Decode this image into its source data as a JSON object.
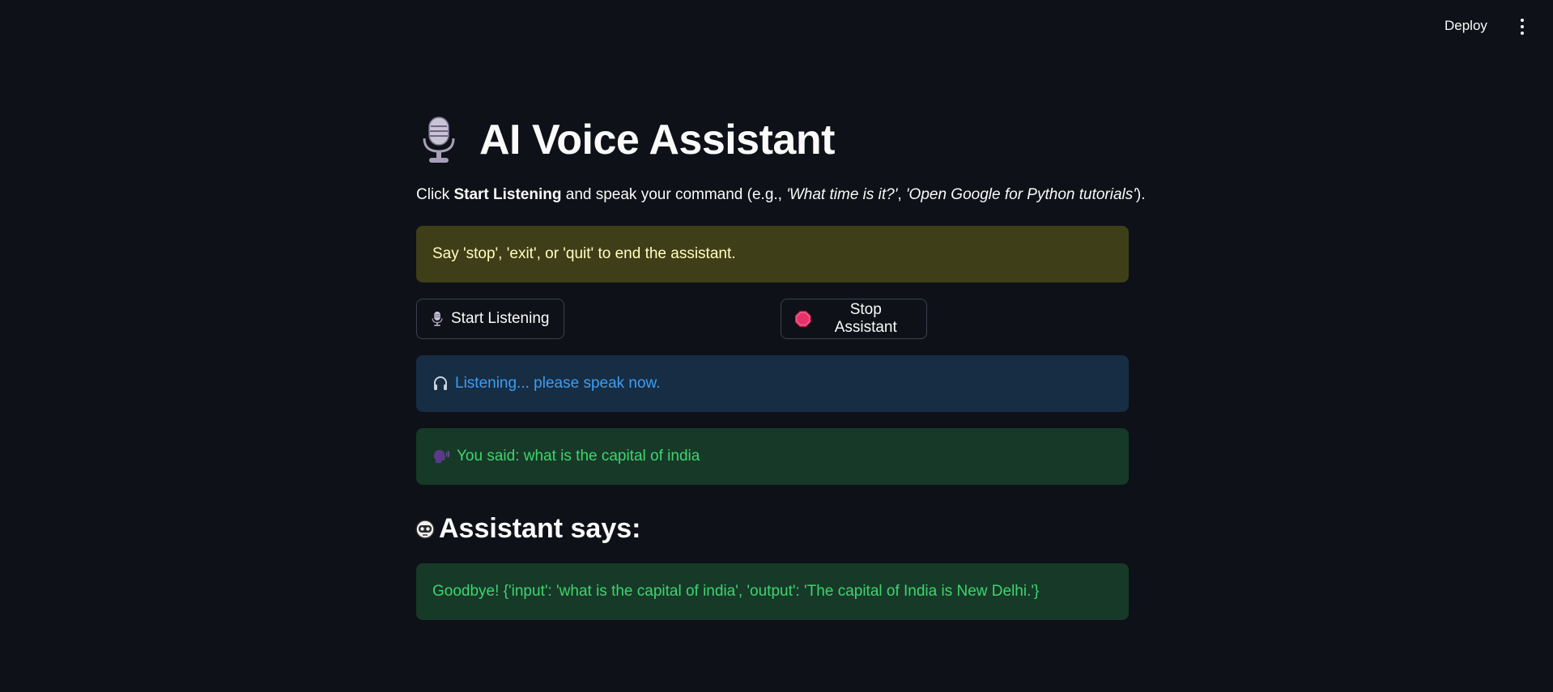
{
  "header": {
    "deploy_label": "Deploy",
    "menu_icon": "kebab-menu-icon"
  },
  "page": {
    "title_icon": "microphone-icon",
    "title": "AI Voice Assistant",
    "intro": {
      "prefix": "Click ",
      "bold": "Start Listening",
      "middle": " and speak your command (e.g., ",
      "example1": "'What time is it?'",
      "sep": ", ",
      "example2": "'Open Google for Python tutorials'",
      "suffix": ")."
    }
  },
  "warning": {
    "text": "Say 'stop', 'exit', or 'quit' to end the assistant."
  },
  "buttons": {
    "start": {
      "icon": "microphone-icon",
      "label": "Start Listening"
    },
    "stop": {
      "icon": "stop-sign-icon",
      "label": "Stop Assistant"
    }
  },
  "status": {
    "listening": {
      "icon": "headphones-icon",
      "text": "Listening... please speak now."
    },
    "heard": {
      "icon": "speaking-head-icon",
      "text": "You said: what is the capital of india"
    }
  },
  "response": {
    "heading_icon": "robot-icon",
    "heading": "Assistant says:",
    "text": "Goodbye! {'input': 'what is the capital of india', 'output': 'The capital of India is New Delhi.'}"
  },
  "colors": {
    "background": "#0e1117",
    "warning_bg": "#3e3f18",
    "warning_text": "#ffffc2",
    "info_bg": "#172d43",
    "info_text": "#3d9df3",
    "success_bg": "#173928",
    "success_text": "#3dd56d",
    "button_border": "#3d4150"
  }
}
